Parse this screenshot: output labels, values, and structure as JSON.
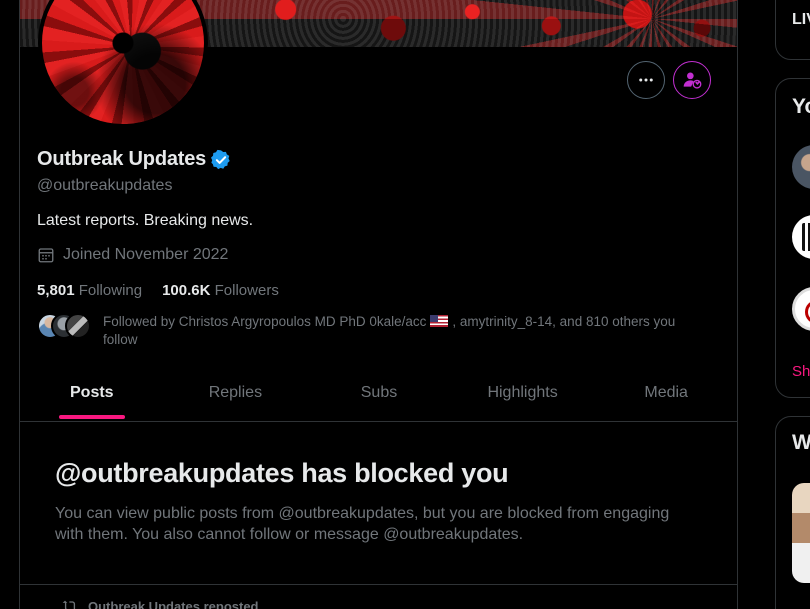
{
  "profile": {
    "display_name": "Outbreak Updates",
    "handle": "@outbreakupdates",
    "bio": "Latest reports. Breaking news.",
    "joined": "Joined November 2022",
    "following_count": "5,801",
    "following_label": "Following",
    "followers_count": "100.6K",
    "followers_label": "Followers",
    "followed_by_prefix": "Followed by Christos Argyropoulos MD PhD 0kale/acc",
    "followed_by_suffix": ", amytrinity_8-14, and 810 others you follow",
    "verified": true,
    "accent_color": "#1d9bf0"
  },
  "actions": {
    "more_icon": "more-horizontal-icon",
    "blocked_icon": "blocked-user-icon",
    "blocked_color": "#c22fd1"
  },
  "tabs": [
    {
      "label": "Posts",
      "active": true
    },
    {
      "label": "Replies",
      "active": false
    },
    {
      "label": "Subs",
      "active": false
    },
    {
      "label": "Highlights",
      "active": false
    },
    {
      "label": "Media",
      "active": false
    }
  ],
  "tab_accent": "#f91880",
  "blocked_notice": {
    "title": "@outbreakupdates has blocked you",
    "description": "You can view public posts from @outbreakupdates, but you are blocked from engaging with them. You also cannot follow or message @outbreakupdates."
  },
  "feed": {
    "repost_label": "Outbreak Updates reposted"
  },
  "sidebar": {
    "live_label": "LIV",
    "you_label": "Yo",
    "what_label": "W",
    "show_more": "Sh"
  }
}
